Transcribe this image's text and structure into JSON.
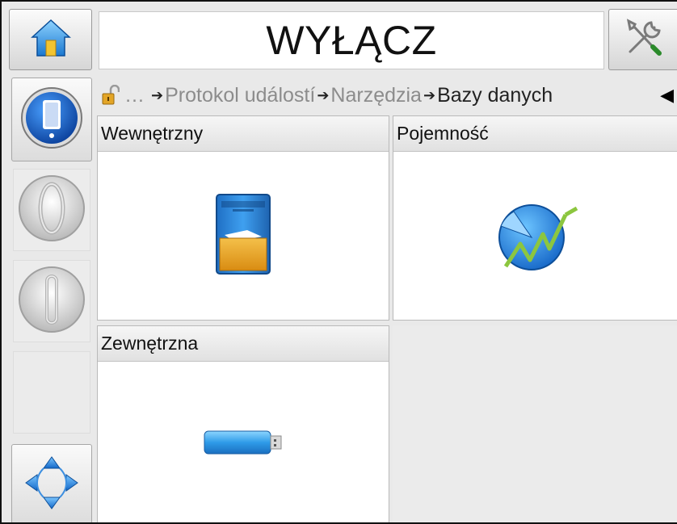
{
  "header": {
    "title": "WYŁĄCZ",
    "home_icon": "home-icon",
    "tools_icon": "tools-icon"
  },
  "left_panel": {
    "print_button_icon": "printhead-icon",
    "start_icon": "start-icon",
    "stop_icon": "stop-icon",
    "navigation_icon": "navigation-arrows-icon"
  },
  "breadcrumb": {
    "lock_icon": "unlocked-padlock-icon",
    "ellipsis": "…",
    "items": [
      "Protokol událostí",
      "Narzędzia",
      "Bazy danych"
    ],
    "arrow": "➔",
    "back_glyph": "◀"
  },
  "tiles": [
    {
      "label": "Wewnętrzny",
      "icon": "internal-storage-cabinet-icon"
    },
    {
      "label": "Pojemność",
      "icon": "capacity-chart-icon"
    },
    {
      "label": "Zewnętrzna",
      "icon": "usb-drive-icon"
    }
  ],
  "colors": {
    "accent_blue": "#2a6fd6",
    "folder_yellow": "#e7a521",
    "chart_green": "#8cc63f"
  }
}
